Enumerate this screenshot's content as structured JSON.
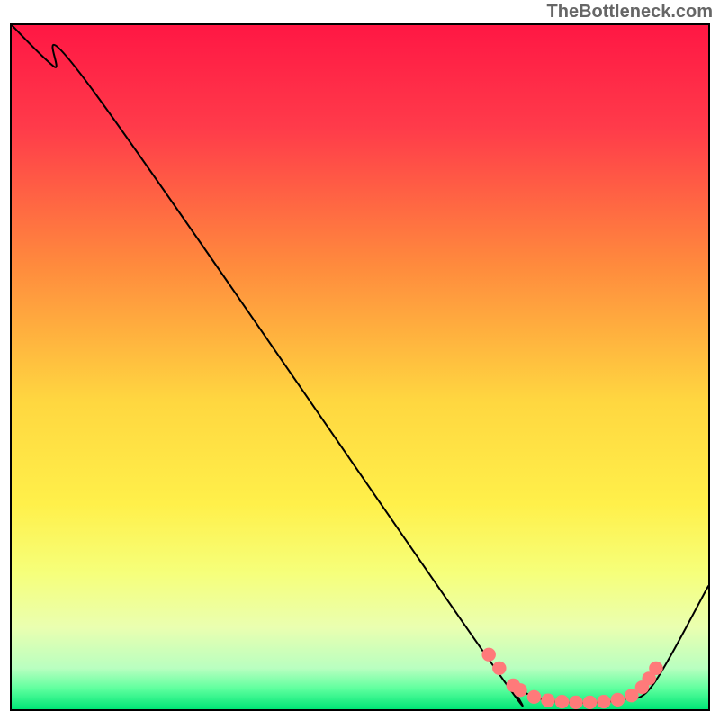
{
  "watermark": "TheBottleneck.com",
  "chart_data": {
    "type": "line",
    "title": "",
    "xlabel": "",
    "ylabel": "",
    "xlim": [
      0,
      100
    ],
    "ylim": [
      0,
      100
    ],
    "gradient_stops": [
      {
        "offset": 0,
        "color": "#ff1744"
      },
      {
        "offset": 15,
        "color": "#ff3b4a"
      },
      {
        "offset": 35,
        "color": "#ff8a3d"
      },
      {
        "offset": 55,
        "color": "#ffd740"
      },
      {
        "offset": 70,
        "color": "#fff04a"
      },
      {
        "offset": 80,
        "color": "#f6ff7a"
      },
      {
        "offset": 88,
        "color": "#eaffb0"
      },
      {
        "offset": 94,
        "color": "#b9ffc0"
      },
      {
        "offset": 97,
        "color": "#5eff9e"
      },
      {
        "offset": 100,
        "color": "#00e676"
      }
    ],
    "series": [
      {
        "name": "bottleneck-curve",
        "x": [
          0,
          6,
          12,
          68,
          72,
          76,
          80,
          84,
          88,
          92,
          100
        ],
        "y": [
          100,
          94,
          90,
          8,
          3.5,
          1.5,
          1,
          1,
          1.5,
          3.5,
          18
        ]
      }
    ],
    "markers": {
      "name": "highlight-dots",
      "color": "#ff7a7a",
      "points": [
        {
          "x": 68.5,
          "y": 8.0
        },
        {
          "x": 70.0,
          "y": 6.0
        },
        {
          "x": 72.0,
          "y": 3.5
        },
        {
          "x": 73.0,
          "y": 2.8
        },
        {
          "x": 75.0,
          "y": 1.8
        },
        {
          "x": 77.0,
          "y": 1.3
        },
        {
          "x": 79.0,
          "y": 1.1
        },
        {
          "x": 81.0,
          "y": 1.0
        },
        {
          "x": 83.0,
          "y": 1.0
        },
        {
          "x": 85.0,
          "y": 1.1
        },
        {
          "x": 87.0,
          "y": 1.4
        },
        {
          "x": 89.0,
          "y": 2.0
        },
        {
          "x": 90.5,
          "y": 3.2
        },
        {
          "x": 91.5,
          "y": 4.5
        },
        {
          "x": 92.5,
          "y": 6.0
        }
      ]
    }
  }
}
